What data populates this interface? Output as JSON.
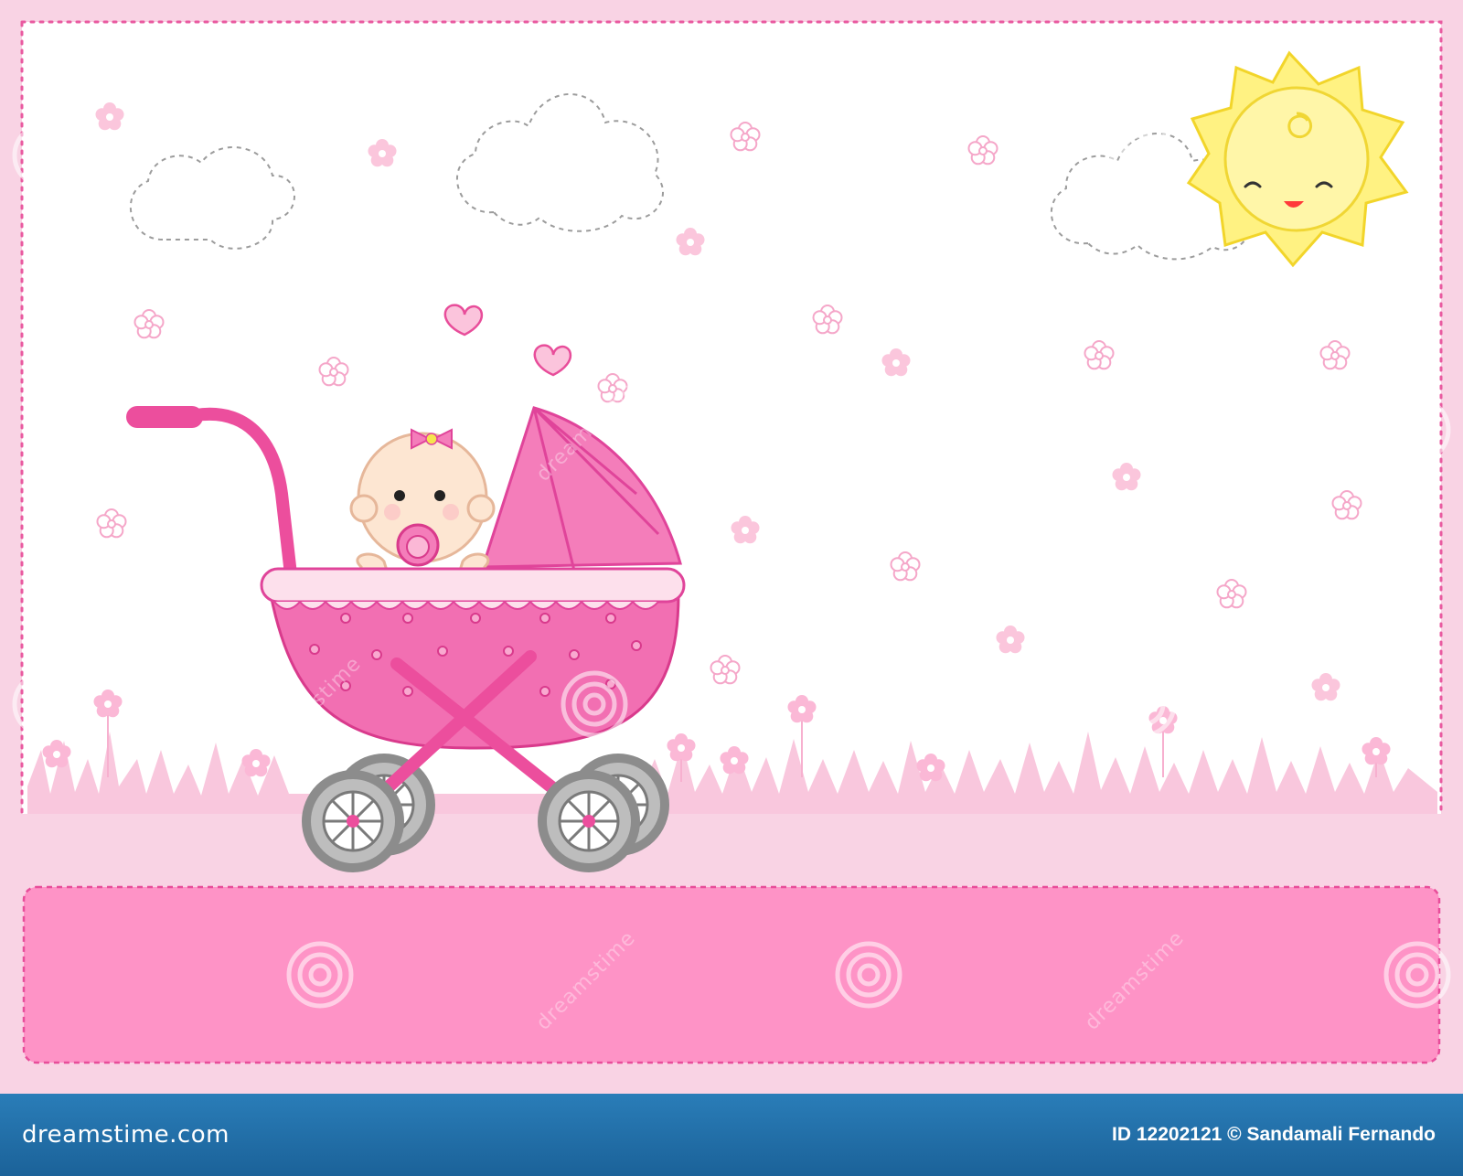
{
  "footer": {
    "brand": "dreamstime.com",
    "credit": "ID 12202121 © Sandamali Fernando"
  },
  "watermark": {
    "text": "dreamstime"
  },
  "colors": {
    "background": "#f9d3e4",
    "card": "#ffffff",
    "border": "#e95aa0",
    "banner": "#fe93c6",
    "grass": "#f9c7dd",
    "sun": "#fff282",
    "pram": "#f26fb2",
    "footer": "#1f6faa"
  },
  "icons": [
    "sun-icon",
    "cloud-icon",
    "flower-icon",
    "heart-icon",
    "baby-icon",
    "pram-icon"
  ]
}
